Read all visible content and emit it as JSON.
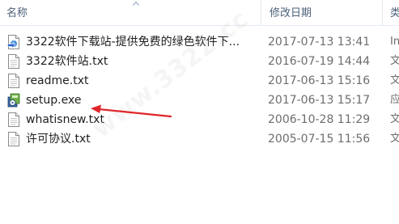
{
  "header": {
    "name_label": "名称",
    "date_label": "修改日期",
    "type_label": "类"
  },
  "files": [
    {
      "name": "3322软件下载站-提供免费的绿色软件下...",
      "date": "2017-07-13 13:41",
      "type": "In",
      "icon": "internet-shortcut-icon"
    },
    {
      "name": "3322软件站.txt",
      "date": "2016-07-19 14:44",
      "type": "文",
      "icon": "text-file-icon"
    },
    {
      "name": "readme.txt",
      "date": "2017-06-13 15:16",
      "type": "文",
      "icon": "text-file-icon"
    },
    {
      "name": "setup.exe",
      "date": "2017-06-13 15:17",
      "type": "应",
      "icon": "installer-icon"
    },
    {
      "name": "whatisnew.txt",
      "date": "2006-10-28 11:29",
      "type": "文",
      "icon": "text-file-icon"
    },
    {
      "name": "许可协议.txt",
      "date": "2005-07-15 11:56",
      "type": "文",
      "icon": "text-file-icon"
    }
  ],
  "watermark": "www.3322.cc",
  "colors": {
    "header_text": "#4c607a",
    "arrow": "#e0262a",
    "date_text": "#6d6d6d"
  }
}
